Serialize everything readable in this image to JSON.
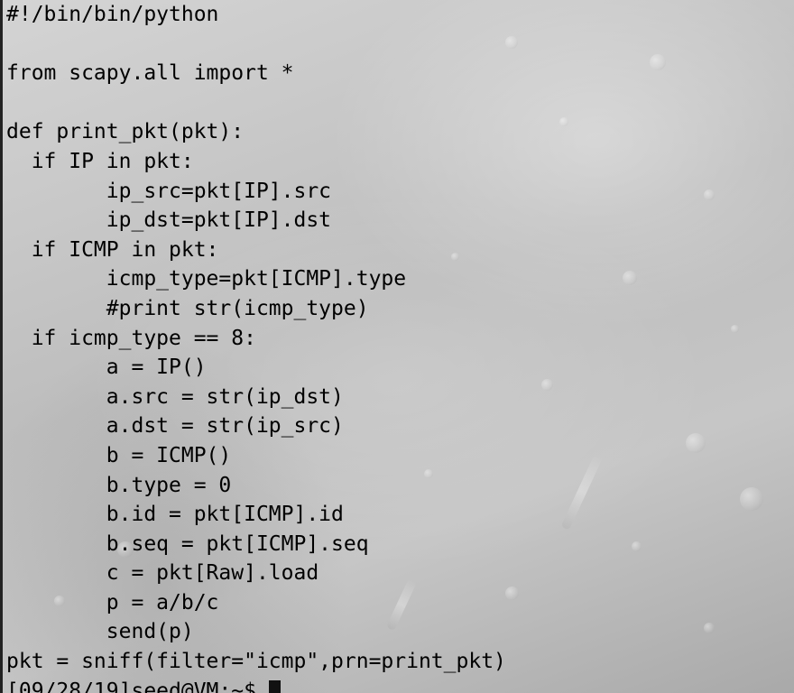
{
  "terminal": {
    "code_lines": [
      "#!/bin/bin/python",
      "",
      "from scapy.all import *",
      "",
      "def print_pkt(pkt):",
      "  if IP in pkt:",
      "        ip_src=pkt[IP].src",
      "        ip_dst=pkt[IP].dst",
      "  if ICMP in pkt:",
      "        icmp_type=pkt[ICMP].type",
      "        #print str(icmp_type)",
      "  if icmp_type == 8:",
      "        a = IP()",
      "        a.src = str(ip_dst)",
      "        a.dst = str(ip_src)",
      "        b = ICMP()",
      "        b.type = 0",
      "        b.id = pkt[ICMP].id",
      "        b.seq = pkt[ICMP].seq",
      "        c = pkt[Raw].load",
      "        p = a/b/c",
      "        send(p)",
      "pkt = sniff(filter=\"icmp\",prn=print_pkt)"
    ],
    "prompt_partial": "[09/28/19]seed@VM:~$ "
  }
}
